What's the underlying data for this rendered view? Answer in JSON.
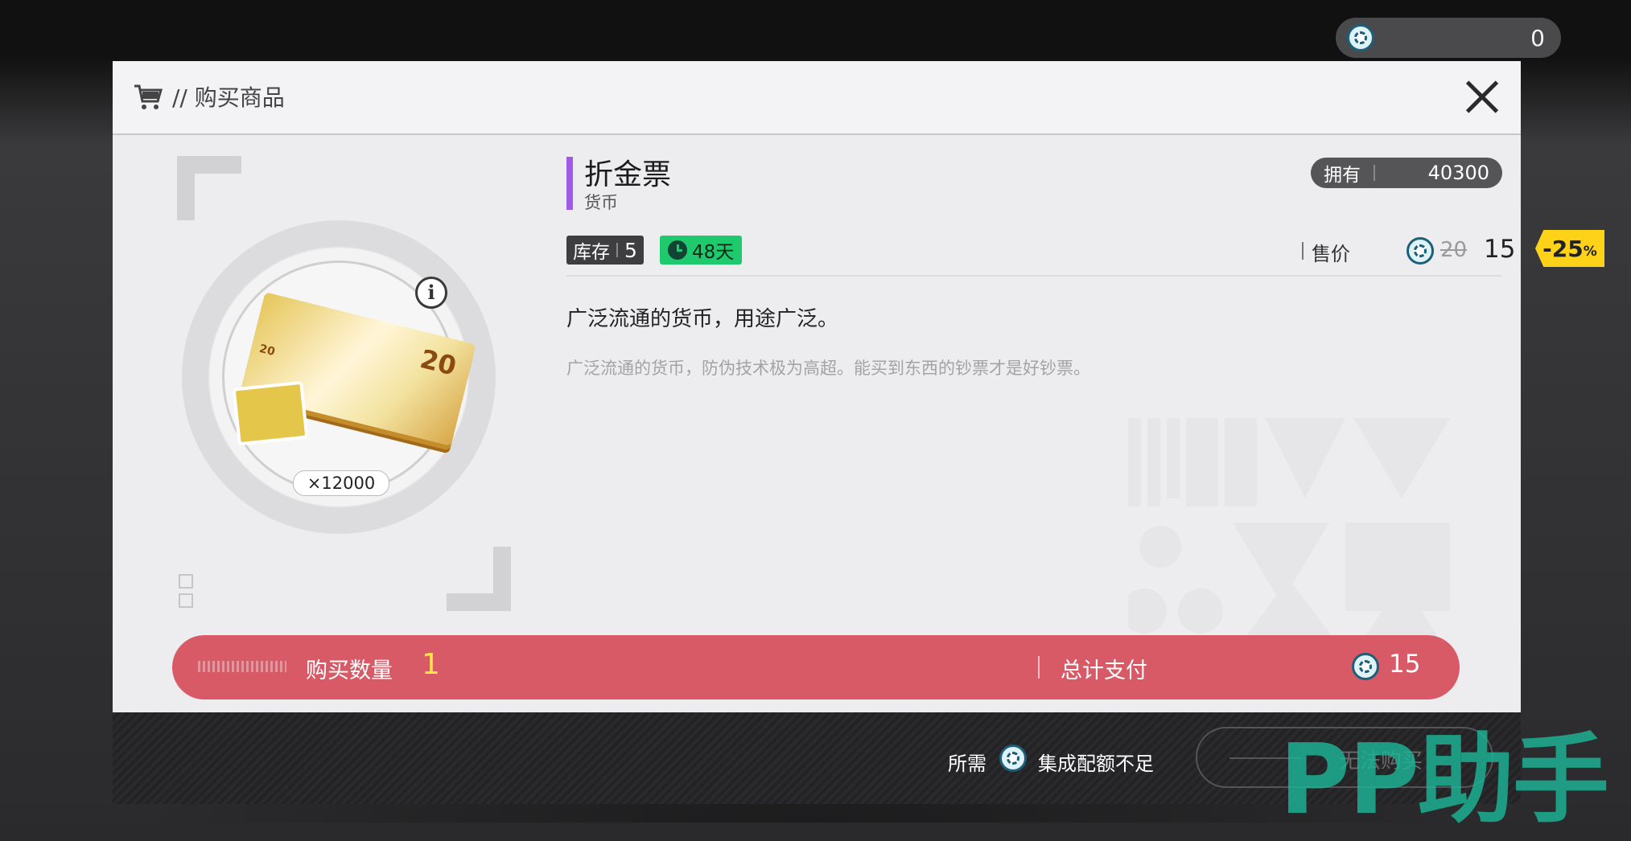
{
  "top_currency": {
    "icon": "quota-coin-icon",
    "amount": "0"
  },
  "dialog": {
    "title": "// 购买商品",
    "item": {
      "name": "折金票",
      "type": "货币",
      "bundle_qty": "×12000",
      "bill_denom": "20",
      "bill_small": "20",
      "accent_color": "#a05ae8"
    },
    "owned": {
      "label": "拥有",
      "value": "40300"
    },
    "stock": {
      "label": "库存",
      "value": "5"
    },
    "timer": {
      "value": "48天",
      "color": "#1fca6e"
    },
    "price": {
      "label": "售价",
      "original": "20",
      "current": "15",
      "discount": "-25",
      "discount_unit": "%",
      "discount_color": "#ffd21a"
    },
    "description": {
      "main": "广泛流通的货币，用途广泛。",
      "flavor": "广泛流通的货币，防伪技术极为高超。能买到东西的钞票才是好钞票。"
    },
    "purchase": {
      "qty_label": "购买数量",
      "qty_value": "1",
      "total_label": "总计支付",
      "total_value": "15",
      "bar_color": "#d75a66"
    },
    "footer": {
      "required_label": "所需",
      "message": "集成配额不足",
      "buy_label": "无法购买"
    }
  },
  "watermark": "PP助手"
}
